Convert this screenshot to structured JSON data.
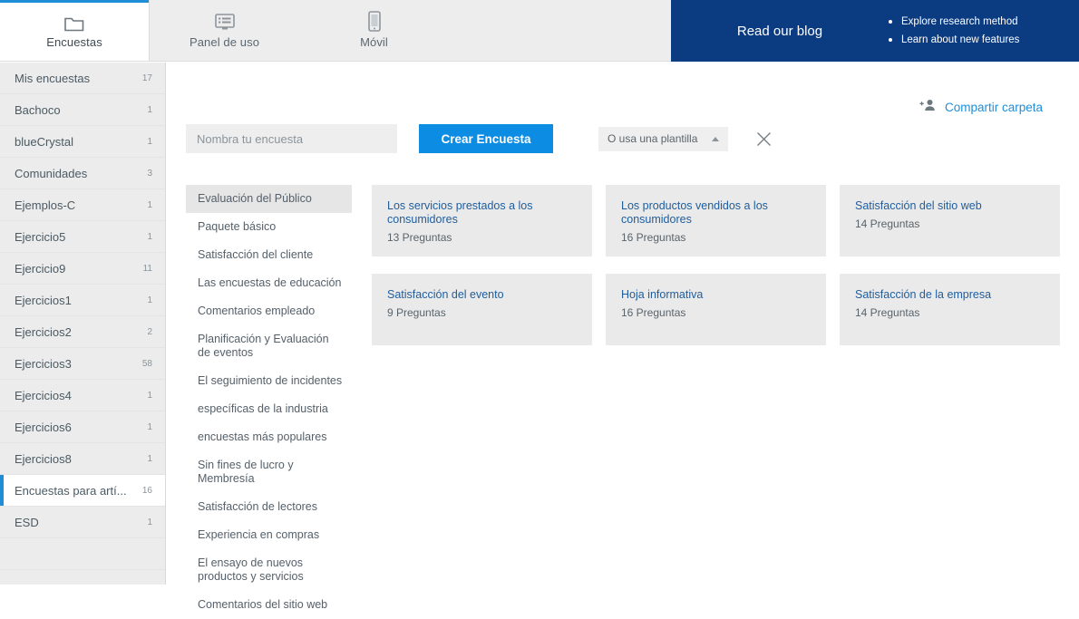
{
  "topnav": {
    "tabs": [
      {
        "label": "Encuestas",
        "icon": "folder-icon",
        "active": true
      },
      {
        "label": "Panel de uso",
        "icon": "dashboard-monitor-icon",
        "active": false
      },
      {
        "label": "Móvil",
        "icon": "mobile-phone-icon",
        "active": false
      }
    ],
    "banner": {
      "title": "Read our blog",
      "links": [
        "Explore research method",
        "Learn about new features"
      ],
      "background": "#0b3b81"
    }
  },
  "sidebar": {
    "items": [
      {
        "label": "Mis encuestas",
        "count": "17",
        "active": false
      },
      {
        "label": "Bachoco",
        "count": "1",
        "active": false
      },
      {
        "label": "blueCrystal",
        "count": "1",
        "active": false
      },
      {
        "label": "Comunidades",
        "count": "3",
        "active": false
      },
      {
        "label": "Ejemplos-C",
        "count": "1",
        "active": false
      },
      {
        "label": "Ejercicio5",
        "count": "1",
        "active": false
      },
      {
        "label": "Ejercicio9",
        "count": "11",
        "active": false
      },
      {
        "label": "Ejercicios1",
        "count": "1",
        "active": false
      },
      {
        "label": "Ejercicios2",
        "count": "2",
        "active": false
      },
      {
        "label": "Ejercicios3",
        "count": "58",
        "active": false
      },
      {
        "label": "Ejercicios4",
        "count": "1",
        "active": false
      },
      {
        "label": "Ejercicios6",
        "count": "1",
        "active": false
      },
      {
        "label": "Ejercicios8",
        "count": "1",
        "active": false
      },
      {
        "label": "Encuestas para artí...",
        "count": "16",
        "active": true
      },
      {
        "label": "ESD",
        "count": "1",
        "active": false
      },
      {
        "label": "",
        "count": "",
        "active": false
      }
    ]
  },
  "main": {
    "share": {
      "label": "Compartir carpeta",
      "icon": "add-person-icon",
      "color": "#1f8ed6"
    },
    "toolbar": {
      "name_placeholder": "Nombra tu encuesta",
      "name_value": "",
      "create_label": "Crear Encuesta",
      "create_color": "#0c8ce3",
      "template_select_label": "O usa una plantilla",
      "close_icon": "close-icon"
    },
    "categories": [
      {
        "label": "Evaluación del Público",
        "active": true
      },
      {
        "label": "Paquete básico",
        "active": false
      },
      {
        "label": "Satisfacción del cliente",
        "active": false
      },
      {
        "label": "Las encuestas de educación",
        "active": false
      },
      {
        "label": "Comentarios empleado",
        "active": false
      },
      {
        "label": "Planificación y Evaluación de eventos",
        "active": false
      },
      {
        "label": "El seguimiento de incidentes",
        "active": false
      },
      {
        "label": "específicas de la industria",
        "active": false
      },
      {
        "label": "encuestas más populares",
        "active": false
      },
      {
        "label": "Sin fines de lucro y Membresía",
        "active": false
      },
      {
        "label": "Satisfacción de lectores",
        "active": false
      },
      {
        "label": "Experiencia en compras",
        "active": false
      },
      {
        "label": "El ensayo de nuevos productos y servicios",
        "active": false
      },
      {
        "label": "Comentarios del sitio web",
        "active": false
      }
    ],
    "cards": [
      {
        "title": "Los servicios prestados a los consumidores",
        "questions": "13 Preguntas"
      },
      {
        "title": "Los productos vendidos a los consumidores",
        "questions": "16 Preguntas"
      },
      {
        "title": "Satisfacción del sitio web",
        "questions": "14 Preguntas"
      },
      {
        "title": "Satisfacción del evento",
        "questions": "9 Preguntas"
      },
      {
        "title": "Hoja informativa",
        "questions": "16 Preguntas"
      },
      {
        "title": "Satisfacción de la empresa",
        "questions": "14 Preguntas"
      }
    ]
  }
}
